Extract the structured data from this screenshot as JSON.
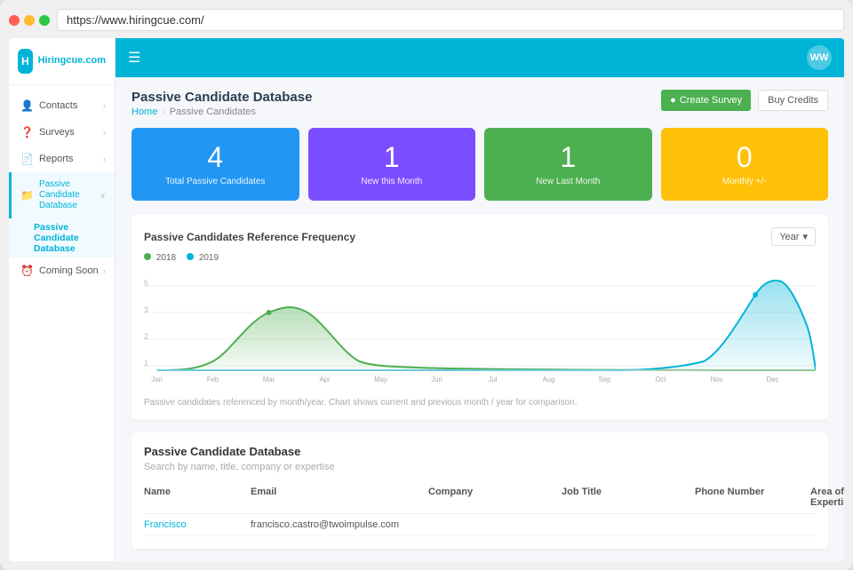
{
  "browser": {
    "url": "https://www.hiringcue.com/"
  },
  "sidebar": {
    "logo_letter": "H",
    "logo_name": "Hiringcue.com",
    "items": [
      {
        "id": "contacts",
        "label": "Contacts",
        "icon": "👤",
        "has_arrow": true
      },
      {
        "id": "surveys",
        "label": "Surveys",
        "icon": "❓",
        "has_arrow": true
      },
      {
        "id": "reports",
        "label": "Reports",
        "icon": "📄",
        "has_arrow": true
      },
      {
        "id": "passive-candidate",
        "label": "Passive Candidate Database",
        "icon": "📁",
        "active": true,
        "has_arrow": true
      },
      {
        "id": "coming-soon",
        "label": "Coming Soon",
        "icon": "⏰",
        "has_arrow": true
      }
    ],
    "active_sub": "Passive Candidate Database"
  },
  "topbar": {
    "avatar": "WW"
  },
  "page": {
    "title": "Passive Candidate Database",
    "breadcrumb_home": "Home",
    "breadcrumb_current": "Passive Candidates",
    "btn_create": "Create Survey",
    "btn_buy": "Buy Credits"
  },
  "stats": [
    {
      "id": "total",
      "number": "4",
      "label": "Total Passive Candidates",
      "color_class": "card-blue"
    },
    {
      "id": "new-month",
      "number": "1",
      "label": "New this Month",
      "color_class": "card-purple"
    },
    {
      "id": "new-last",
      "number": "1",
      "label": "New Last Month",
      "color_class": "card-green"
    },
    {
      "id": "monthly",
      "number": "0",
      "label": "Monthly +/-",
      "color_class": "card-yellow"
    }
  ],
  "chart": {
    "title": "Passive Candidates Reference Frequency",
    "filter": "Year",
    "legend": [
      {
        "label": "2018",
        "color": "#4caf50"
      },
      {
        "label": "2019",
        "color": "#00b4d8"
      }
    ],
    "x_labels": [
      "Jan",
      "Feb",
      "Mar",
      "Apr",
      "May",
      "Jun",
      "Jul",
      "Aug",
      "Sep",
      "Oct",
      "Nov",
      "Dec"
    ],
    "note": "Passive candidates referenced by month/year. Chart shows current and previous month / year for comparison."
  },
  "database": {
    "title": "Passive Candidate Database",
    "search_hint": "Search by name, title, company or expertise",
    "columns": [
      "Name",
      "Email",
      "Company",
      "Job Title",
      "Phone Number",
      "Area of Expertise"
    ],
    "rows": [
      {
        "name": "Francisco",
        "email": "francisco.castro@twoimpulse.com",
        "company": "",
        "job_title": "",
        "phone": "",
        "expertise": ""
      }
    ]
  }
}
